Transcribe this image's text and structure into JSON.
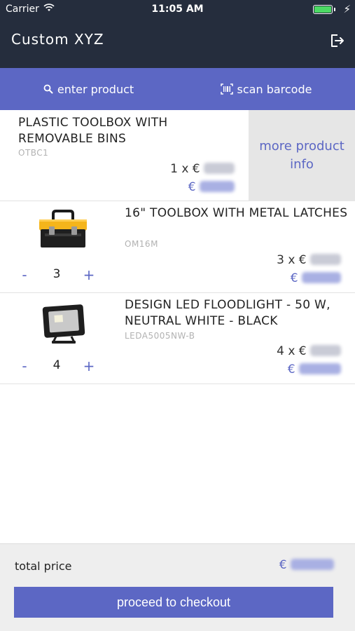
{
  "status_bar": {
    "carrier": "Carrier",
    "time": "11:05 AM",
    "battery_level": 1.0
  },
  "app": {
    "title": "Custom XYZ",
    "logout_icon": "logout-icon"
  },
  "search": {
    "enter_label": "enter product",
    "enter_icon": "search-icon",
    "scan_label": "scan barcode",
    "scan_icon": "barcode-icon"
  },
  "products": [
    {
      "name": "PLASTIC TOOLBOX WITH REMOVABLE BINS",
      "sku": "OTBC1",
      "qty_text": "1 x €",
      "total_currency": "€",
      "more_info_label": "more product info"
    },
    {
      "name": "16\" TOOLBOX WITH METAL LATCHES",
      "sku": "OM16M",
      "qty": "3",
      "qty_text": "3 x €",
      "total_currency": "€",
      "minus": "-",
      "plus": "+",
      "image": "toolbox-image"
    },
    {
      "name": "DESIGN LED FLOODLIGHT - 50 W, NEUTRAL WHITE - BLACK",
      "sku": "LEDA5005NW-B",
      "qty": "4",
      "qty_text": "4 x €",
      "total_currency": "€",
      "minus": "-",
      "plus": "+",
      "image": "floodlight-image"
    }
  ],
  "footer": {
    "total_label": "total price",
    "total_currency": "€",
    "checkout_label": "proceed to checkout"
  },
  "colors": {
    "header_bg": "#252d3d",
    "accent": "#5c67c4",
    "more_info_bg": "#e6e6e6",
    "footer_bg": "#eeeeee"
  }
}
